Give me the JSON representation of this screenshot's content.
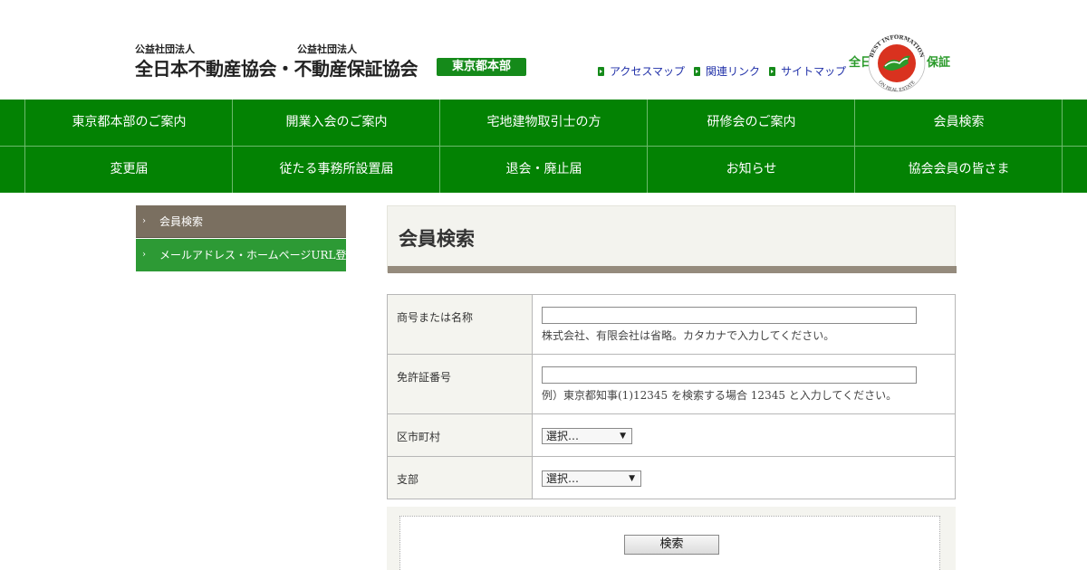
{
  "header": {
    "logo_small_1": "公益社団法人",
    "logo_small_2": "公益社団法人",
    "logo_main": "全日本不動産協会・不動産保証協会",
    "logo_badge": "東京都本部",
    "links": [
      {
        "label": "アクセスマップ"
      },
      {
        "label": "関連リンク"
      },
      {
        "label": "サイトマップ"
      }
    ],
    "seal": {
      "left_text": "全日",
      "right_text": "保証",
      "arc_top": "BEST INFORMATION",
      "arc_bottom": "ON REAL ESTATE",
      "colors": {
        "red": "#d9321f",
        "green": "#2a9a2a"
      }
    }
  },
  "nav": {
    "row1": [
      "東京都本部のご案内",
      "開業入会のご案内",
      "宅地建物取引士の方",
      "研修会のご案内",
      "会員検索"
    ],
    "row2": [
      "変更届",
      "従たる事務所設置届",
      "退会・廃止届",
      "お知らせ",
      "協会会員の皆さま"
    ],
    "color": "#038203"
  },
  "sidebar": {
    "items": [
      {
        "label": "会員検索",
        "state": "active"
      },
      {
        "label": "メールアドレス・ホームページURL登"
      }
    ]
  },
  "main": {
    "title": "会員検索",
    "form": {
      "name_label": "商号または名称",
      "name_value": "",
      "name_hint": "株式会社、有限会社は省略。カタカナで入力してください。",
      "license_label": "免許証番号",
      "license_value": "",
      "license_hint": "例）東京都知事(1)12345 を検索する場合 12345 と入力してください。",
      "city_label": "区市町村",
      "city_selected": "選択…",
      "branch_label": "支部",
      "branch_selected": "選択…",
      "search_button": "検索"
    }
  }
}
